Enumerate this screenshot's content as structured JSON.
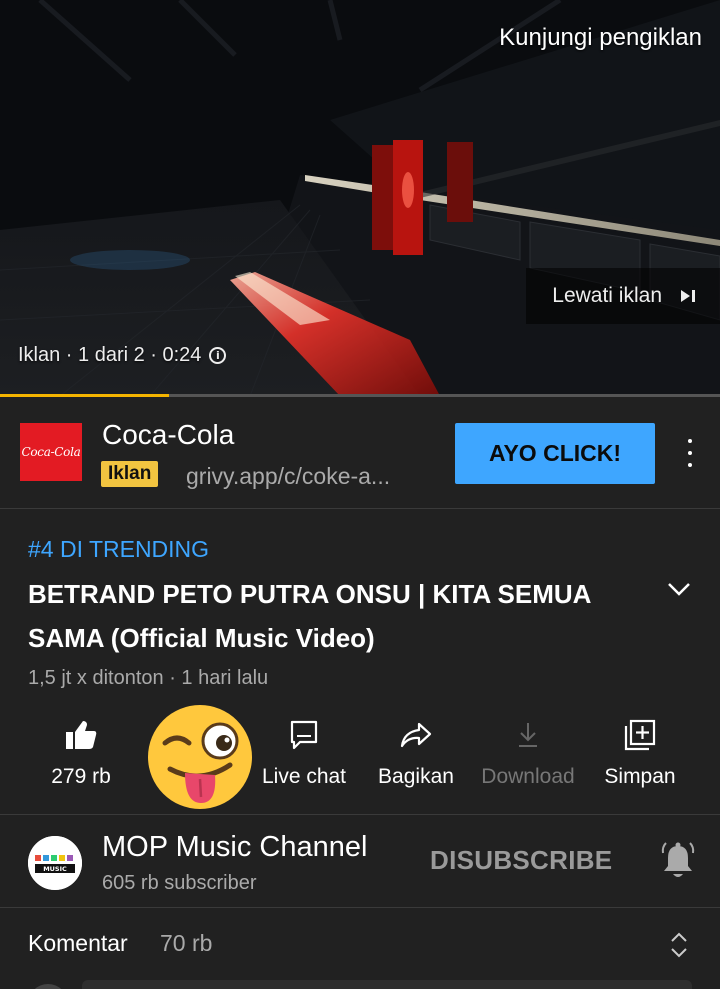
{
  "ad_player": {
    "visit_advertiser": "Kunjungi pengiklan",
    "skip_label": "Lewati iklan",
    "ad_info": "Iklan · 1 dari 2 · 0:24",
    "progress_fraction": 0.235,
    "progress_color": "#f4b400"
  },
  "ad_banner": {
    "brand_logo_text": "Coca-Cola",
    "brand_name": "Coca-Cola",
    "badge": "Iklan",
    "url": "grivy.app/c/coke-a...",
    "cta_label": "AYO CLICK!",
    "cta_color": "#3ea6ff",
    "badge_color": "#f2c440",
    "logo_color": "#e31b23"
  },
  "video": {
    "trending": "#4 DI TRENDING",
    "title": "BETRAND PETO PUTRA ONSU | KITA SEMUA SAMA (Official Music Video)",
    "meta": "1,5 jt x ditonton · 1 hari lalu"
  },
  "actions": {
    "like": "279 rb",
    "live_chat": "Live chat",
    "share": "Bagikan",
    "download": "Download",
    "save": "Simpan"
  },
  "channel": {
    "name": "MOP Music Channel",
    "subscribers": "605 rb subscriber",
    "unsubscribe": "DISUBSCRIBE",
    "avatar_text": "MUSIC"
  },
  "comments": {
    "title": "Komentar",
    "count": "70 rb"
  },
  "colors": {
    "background": "#212121",
    "accent_blue": "#3ea6ff",
    "secondary_text": "#aaaaaa"
  }
}
